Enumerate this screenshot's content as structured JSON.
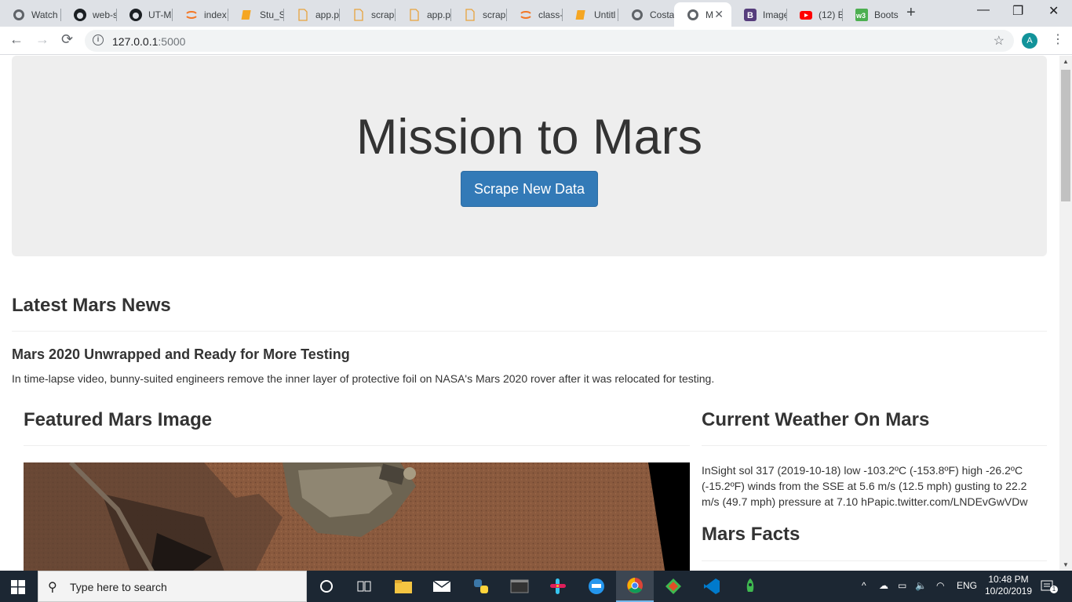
{
  "browser": {
    "tabs": [
      {
        "label": "Watch",
        "icon": "globe-icon"
      },
      {
        "label": "web-s",
        "icon": "github-icon"
      },
      {
        "label": "UT-M",
        "icon": "github-icon"
      },
      {
        "label": "index",
        "icon": "jupyter-icon"
      },
      {
        "label": "Stu_S",
        "icon": "notebook-icon"
      },
      {
        "label": "app.p",
        "icon": "file-icon"
      },
      {
        "label": "scrap",
        "icon": "file-icon"
      },
      {
        "label": "app.p",
        "icon": "file-icon"
      },
      {
        "label": "scrap",
        "icon": "file-icon"
      },
      {
        "label": "class-",
        "icon": "jupyter-icon"
      },
      {
        "label": "Untitl",
        "icon": "notebook-icon"
      },
      {
        "label": "Costa",
        "icon": "globe-icon"
      },
      {
        "label": "M",
        "icon": "globe-icon",
        "active": true
      },
      {
        "label": "Image",
        "icon": "bootstrap-icon"
      },
      {
        "label": "(12) B",
        "icon": "youtube-icon"
      },
      {
        "label": "Boots",
        "icon": "w3schools-icon"
      }
    ],
    "url": {
      "host": "127.0.0.1",
      "port": ":5000"
    },
    "avatar_letter": "A"
  },
  "page": {
    "jumbotron": {
      "title": "Mission to Mars",
      "button_label": "Scrape New Data"
    },
    "news": {
      "heading": "Latest Mars News",
      "title": "Mars 2020 Unwrapped and Ready for More Testing",
      "paragraph": "In time-lapse video, bunny-suited engineers remove the inner layer of protective foil on NASA's Mars 2020 rover after it was relocated for testing."
    },
    "featured": {
      "heading": "Featured Mars Image"
    },
    "weather": {
      "heading": "Current Weather On Mars",
      "text": "InSight sol 317 (2019-10-18) low -103.2ºC (-153.8ºF) high -26.2ºC (-15.2ºF) winds from the SSE at 5.6 m/s (12.5 mph) gusting to 22.2 m/s (49.7 mph) pressure at 7.10 hPapic.twitter.com/LNDEvGwVDw"
    },
    "facts": {
      "heading": "Mars Facts"
    }
  },
  "taskbar": {
    "search_placeholder": "Type here to search",
    "language": "ENG",
    "time": "10:48 PM",
    "date": "10/20/2019",
    "notification_count": "1",
    "colors": {
      "bg": "#1c2733",
      "accent": "#76b9ed"
    }
  },
  "colors": {
    "primary_button": "#337ab7",
    "jumbotron_bg": "#eeeeee",
    "text": "#333333"
  }
}
